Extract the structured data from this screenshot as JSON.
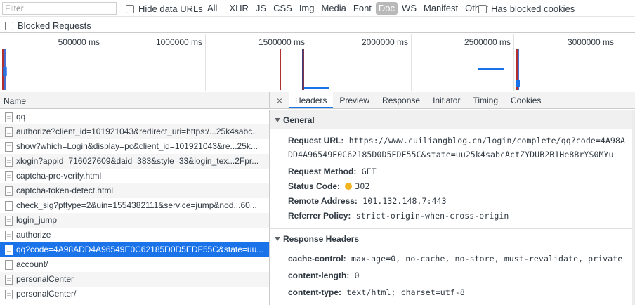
{
  "toolbar": {
    "filter_placeholder": "Filter",
    "hide_data_urls": "Hide data URLs",
    "type_filters": [
      "All",
      "XHR",
      "JS",
      "CSS",
      "Img",
      "Media",
      "Font",
      "Doc",
      "WS",
      "Manifest",
      "Other"
    ],
    "active_filter": "Doc",
    "has_blocked_cookies": "Has blocked cookies",
    "blocked_requests": "Blocked Requests"
  },
  "overview": {
    "ticks": [
      "500000 ms",
      "1000000 ms",
      "1500000 ms",
      "2000000 ms",
      "2500000 ms",
      "3000000 ms"
    ]
  },
  "list": {
    "header": "Name",
    "rows": [
      "qq",
      "authorize?client_id=101921043&redirect_uri=https:/...25k4sabc...",
      "show?which=Login&display=pc&client_id=101921043&re...25k...",
      "xlogin?appid=716027609&daid=383&style=33&login_tex...2Fpr...",
      "captcha-pre-verify.html",
      "captcha-token-detect.html",
      "check_sig?pttype=2&uin=1554382111&service=jump&nod...60...",
      "login_jump",
      "authorize",
      "qq?code=4A98ADD4A96549E0C62185D0D5EDF55C&state=uu...",
      "account/",
      "personalCenter",
      "personalCenter/"
    ],
    "selected_index": 9
  },
  "tabs": {
    "close": "×",
    "items": [
      "Headers",
      "Preview",
      "Response",
      "Initiator",
      "Timing",
      "Cookies"
    ],
    "active": "Headers"
  },
  "general": {
    "title": "General",
    "request_url_label": "Request URL:",
    "request_url": "https://www.cuiliangblog.cn/login/complete/qq?code=4A98ADD4A96549E0C62185D0D5EDF55C&state=uu25k4sabcActZYDUB2B1He8BrYS0MYu",
    "method_label": "Request Method:",
    "method": "GET",
    "status_label": "Status Code:",
    "status": "302",
    "remote_label": "Remote Address:",
    "remote": "101.132.148.7:443",
    "referrer_label": "Referrer Policy:",
    "referrer": "strict-origin-when-cross-origin"
  },
  "response_headers": {
    "title": "Response Headers",
    "cache_label": "cache-control:",
    "cache": "max-age=0, no-cache, no-store, must-revalidate, private",
    "length_label": "content-length:",
    "length": "0",
    "type_label": "content-type:",
    "type": "text/html; charset=utf-8"
  },
  "colors": {
    "selected_row": "#1a73e8",
    "active_filter_bg": "#b9b9b9",
    "status_dot": "#f0b41e"
  }
}
